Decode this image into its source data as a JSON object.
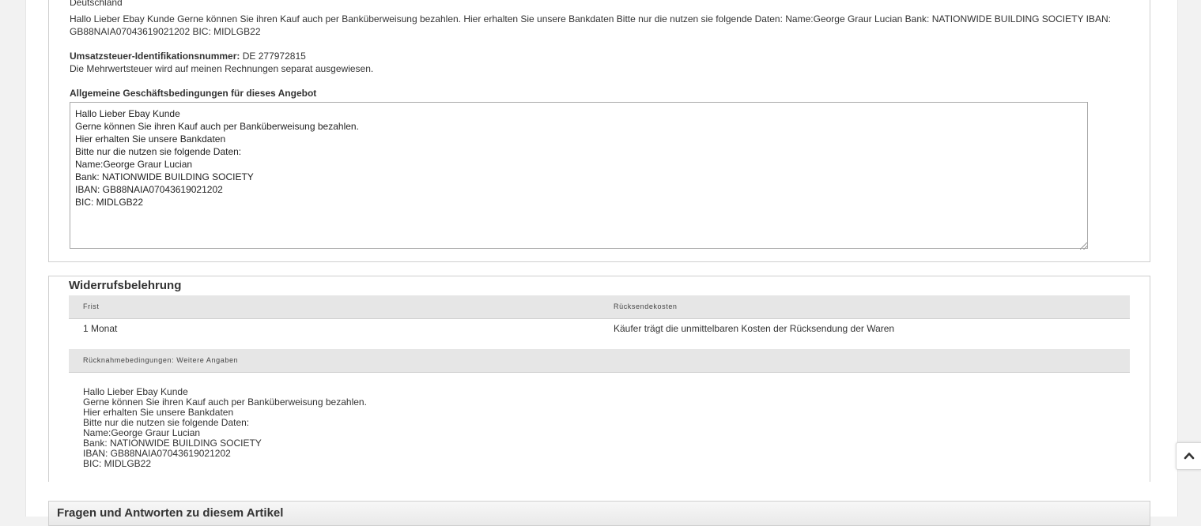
{
  "seller": {
    "country": "Deutschland",
    "intro": "Hallo Lieber Ebay Kunde Gerne können Sie ihren Kauf auch per Banküberweisung bezahlen. Hier erhalten Sie unsere Bankdaten Bitte nur die nutzen sie folgende Daten: Name:George Graur Lucian Bank: NATIONWIDE BUILDING SOCIETY IBAN: GB88NAIA07043619021202 BIC: MIDLGB22",
    "vat_label": "Umsatzsteuer-Identifikationsnummer:",
    "vat_value": "DE 277972815",
    "vat_note": "Die Mehrwertsteuer wird auf meinen Rechnungen separat ausgewiesen.",
    "agb_heading": "Allgemeine Geschäftsbedingungen für dieses Angebot",
    "agb_text": "Hallo Lieber Ebay Kunde\nGerne können Sie ihren Kauf auch per Banküberweisung bezahlen.\nHier erhalten Sie unsere Bankdaten\nBitte nur die nutzen sie folgende Daten:\nName:George Graur Lucian\nBank: NATIONWIDE BUILDING SOCIETY\nIBAN: GB88NAIA07043619021202\nBIC: MIDLGB22"
  },
  "returns": {
    "title": "Widerrufsbelehrung",
    "col_deadline": "Frist",
    "col_costs": "Rücksendekosten",
    "deadline_value": "1 Monat",
    "costs_value": "Käufer trägt die unmittelbaren Kosten der Rücksendung der Waren",
    "more_heading": "Rücknahmebedingungen: Weitere Angaben",
    "more_text": "Hallo Lieber Ebay Kunde\nGerne können Sie ihren Kauf auch per Banküberweisung bezahlen.\nHier erhalten Sie unsere Bankdaten\nBitte nur die nutzen sie folgende Daten:\nName:George Graur Lucian\nBank: NATIONWIDE BUILDING SOCIETY\nIBAN: GB88NAIA07043619021202\nBIC: MIDLGB22"
  },
  "qa": {
    "title": "Fragen und Antworten zu diesem Artikel"
  },
  "icons": {
    "scroll_top": "chevron-up-icon",
    "resize": "resize-grip-icon"
  }
}
